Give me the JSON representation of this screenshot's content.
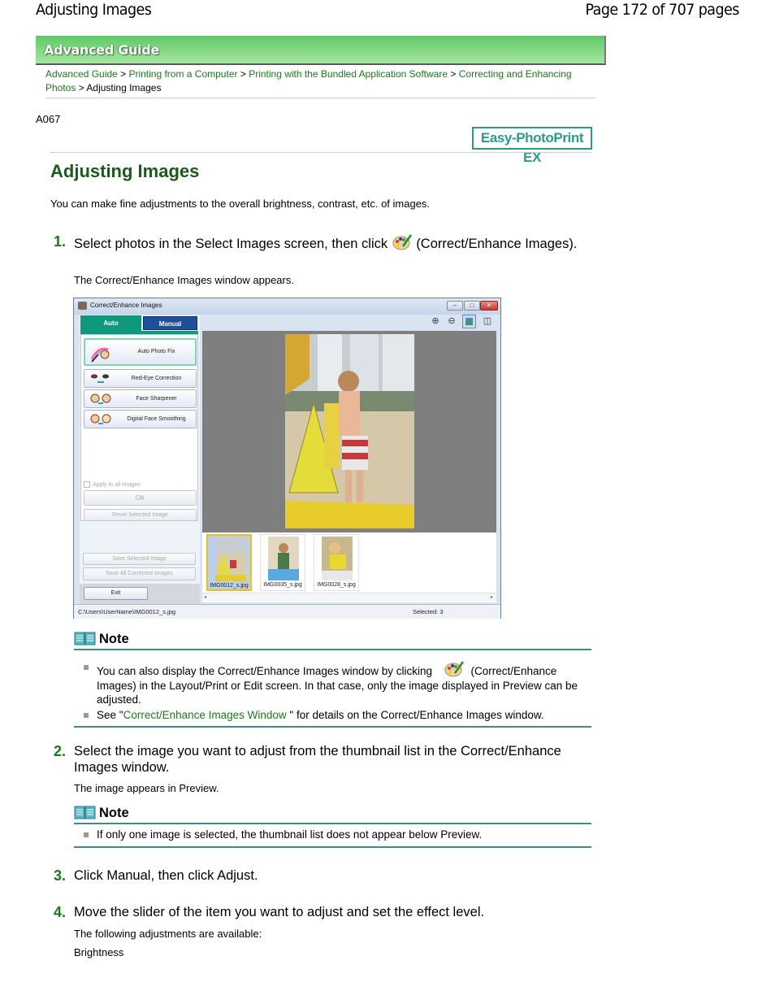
{
  "header": {
    "title": "Adjusting Images",
    "page_info": "Page 172 of 707 pages"
  },
  "banner": {
    "label": "Advanced Guide",
    "color": "#5fc866"
  },
  "breadcrumb": {
    "items": [
      "Advanced Guide",
      "Printing from a Computer",
      "Printing with the Bundled Application Software",
      "Correcting and Enhancing Photos"
    ],
    "separator": ">",
    "current": "Adjusting Images"
  },
  "doc_code": "A067",
  "product_badge": "Easy-PhotoPrint EX",
  "page_title": "Adjusting Images",
  "intro": "You can make fine adjustments to the overall brightness, contrast, etc. of images.",
  "steps": [
    {
      "number": "1.",
      "text_before_icon": "Select photos in the Select Images screen, then click",
      "icon": "correct-enhance-palette-icon",
      "text_after_icon": "(Correct/Enhance Images).",
      "sub": "The Correct/Enhance Images window appears."
    },
    {
      "number": "2.",
      "text": "Select the image you want to adjust from the thumbnail list in the Correct/Enhance Images window.",
      "sub": "The image appears in Preview."
    },
    {
      "number": "3.",
      "text": "Click Manual, then click Adjust."
    },
    {
      "number": "4.",
      "text": "Move the slider of the item you want to adjust and set the effect level.",
      "sub": "The following adjustments are available:",
      "sub2": "Brightness"
    }
  ],
  "window": {
    "title": "Correct/Enhance Images",
    "tabs": [
      {
        "label": "Auto",
        "active": true
      },
      {
        "label": "Manual",
        "active": false
      }
    ],
    "functions": [
      "Auto Photo Fix",
      "Red-Eye Correction",
      "Face Sharpener",
      "Digital Face Smoothing"
    ],
    "apply_all_label": "Apply to all images",
    "apply_all_checked": false,
    "ok_label": "OK",
    "reset_label": "Reset Selected Image",
    "save_selected_label": "Save Selected Image",
    "save_all_label": "Save All Corrected Images",
    "exit_label": "Exit",
    "toolbar": [
      "zoom-in-icon",
      "zoom-out-icon",
      "whole-image-view-icon",
      "compare-view-icon"
    ],
    "thumbnails": [
      {
        "name": "IMG0012_s.jpg",
        "selected": true
      },
      {
        "name": "IMG0035_s.jpg",
        "selected": false
      },
      {
        "name": "IMG0028_s.jpg",
        "selected": false
      }
    ],
    "status_path": "C:\\Users\\UserName\\IMG0012_s.jpg",
    "status_selected": "Selected: 3"
  },
  "note1": {
    "heading": "Note",
    "item1_before": "You can also display the Correct/Enhance Images window by clicking",
    "item1_after": "(Correct/Enhance Images) in the Layout/Print or Edit screen. In that case, only the image displayed in Preview can be adjusted.",
    "item2_before": "See \"",
    "item2_link": "Correct/Enhance Images Window",
    "item2_after": " \" for details on the Correct/Enhance Images window."
  },
  "note2": {
    "heading": "Note",
    "item1": "If only one image is selected, the thumbnail list does not appear below Preview."
  },
  "colors": {
    "link": "#1a7a1a",
    "title": "#1a5a1a",
    "accent_teal": "#2a9a8e"
  }
}
